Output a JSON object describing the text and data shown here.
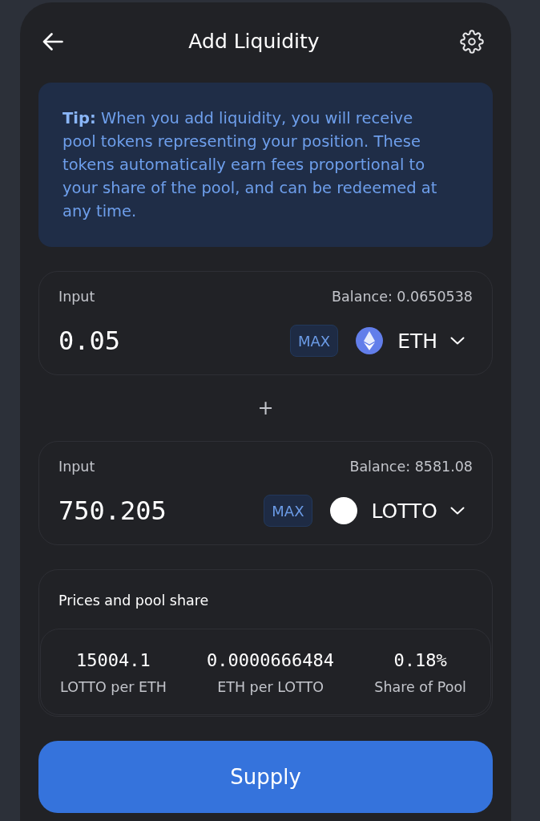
{
  "header": {
    "title": "Add Liquidity"
  },
  "tip": {
    "text": "**Tip:** When you add liquidity, you will receive pool tokens representing your position. These tokens automatically earn fees proportional to your share of the pool, and can be redeemed at any time."
  },
  "inputs": [
    {
      "label": "Input",
      "balance": "Balance: 0.0650538",
      "amount": "0.05",
      "max_label": "MAX",
      "token": {
        "symbol": "ETH",
        "kind": "eth"
      }
    },
    {
      "label": "Input",
      "balance": "Balance: 8581.08",
      "amount": "750.205",
      "max_label": "MAX",
      "token": {
        "symbol": "LOTTO",
        "kind": "plain"
      }
    }
  ],
  "separator": "+",
  "prices": {
    "title": "Prices and pool share",
    "stats": [
      {
        "value": "15004.1",
        "label": "LOTTO per ETH"
      },
      {
        "value": "0.0000666484",
        "label": "ETH per LOTTO"
      },
      {
        "value": "0.18%",
        "label": "Share of Pool"
      }
    ]
  },
  "supply_button": {
    "label": "Supply"
  }
}
